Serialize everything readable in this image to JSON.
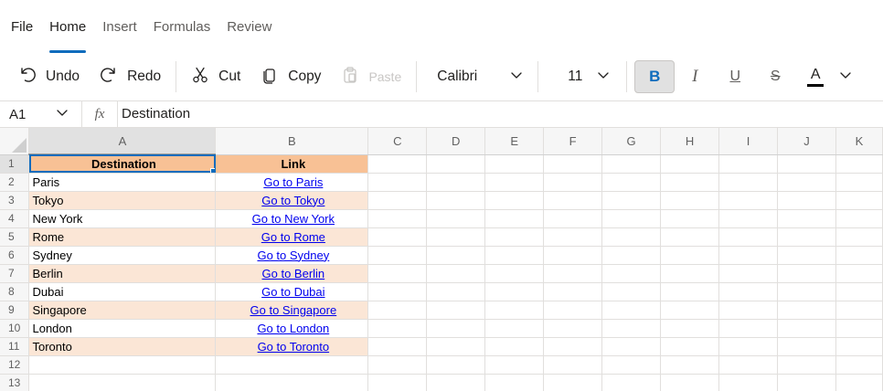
{
  "menu": {
    "tabs": [
      {
        "label": "File",
        "active": false
      },
      {
        "label": "Home",
        "active": true
      },
      {
        "label": "Insert",
        "active": false
      },
      {
        "label": "Formulas",
        "active": false
      },
      {
        "label": "Review",
        "active": false
      }
    ]
  },
  "ribbon": {
    "undo_label": "Undo",
    "redo_label": "Redo",
    "cut_label": "Cut",
    "copy_label": "Copy",
    "paste_label": "Paste",
    "font_name": "Calibri",
    "font_size": "11",
    "bold_glyph": "B",
    "italic_glyph": "I",
    "underline_glyph": "U",
    "strike_glyph": "S",
    "fontcolor_glyph": "A",
    "accent_color": "#0f6cbd"
  },
  "formula_bar": {
    "cell_ref": "A1",
    "fx_label": "fx",
    "value": "Destination"
  },
  "sheet": {
    "columns": [
      "A",
      "B",
      "C",
      "D",
      "E",
      "F",
      "G",
      "H",
      "I",
      "J",
      "K"
    ],
    "rows": [
      "1",
      "2",
      "3",
      "4",
      "5",
      "6",
      "7",
      "8",
      "9",
      "10",
      "11",
      "12",
      "13"
    ],
    "header": {
      "destination": "Destination",
      "link": "Link"
    },
    "data": [
      {
        "destination": "Paris",
        "link": "Go to Paris"
      },
      {
        "destination": "Tokyo",
        "link": "Go to Tokyo"
      },
      {
        "destination": "New York",
        "link": "Go to New York"
      },
      {
        "destination": "Rome",
        "link": "Go to Rome"
      },
      {
        "destination": "Sydney",
        "link": "Go to Sydney"
      },
      {
        "destination": "Berlin",
        "link": "Go to Berlin"
      },
      {
        "destination": "Dubai",
        "link": "Go to Dubai"
      },
      {
        "destination": "Singapore",
        "link": "Go to Singapore"
      },
      {
        "destination": "London",
        "link": "Go to London"
      },
      {
        "destination": "Toronto",
        "link": "Go to Toronto"
      }
    ],
    "colors": {
      "header_fill": "#f8c195",
      "alt_row_fill": "#fbe6d6",
      "hyperlink": "#0000ee",
      "selection": "#0f6cbd"
    }
  }
}
